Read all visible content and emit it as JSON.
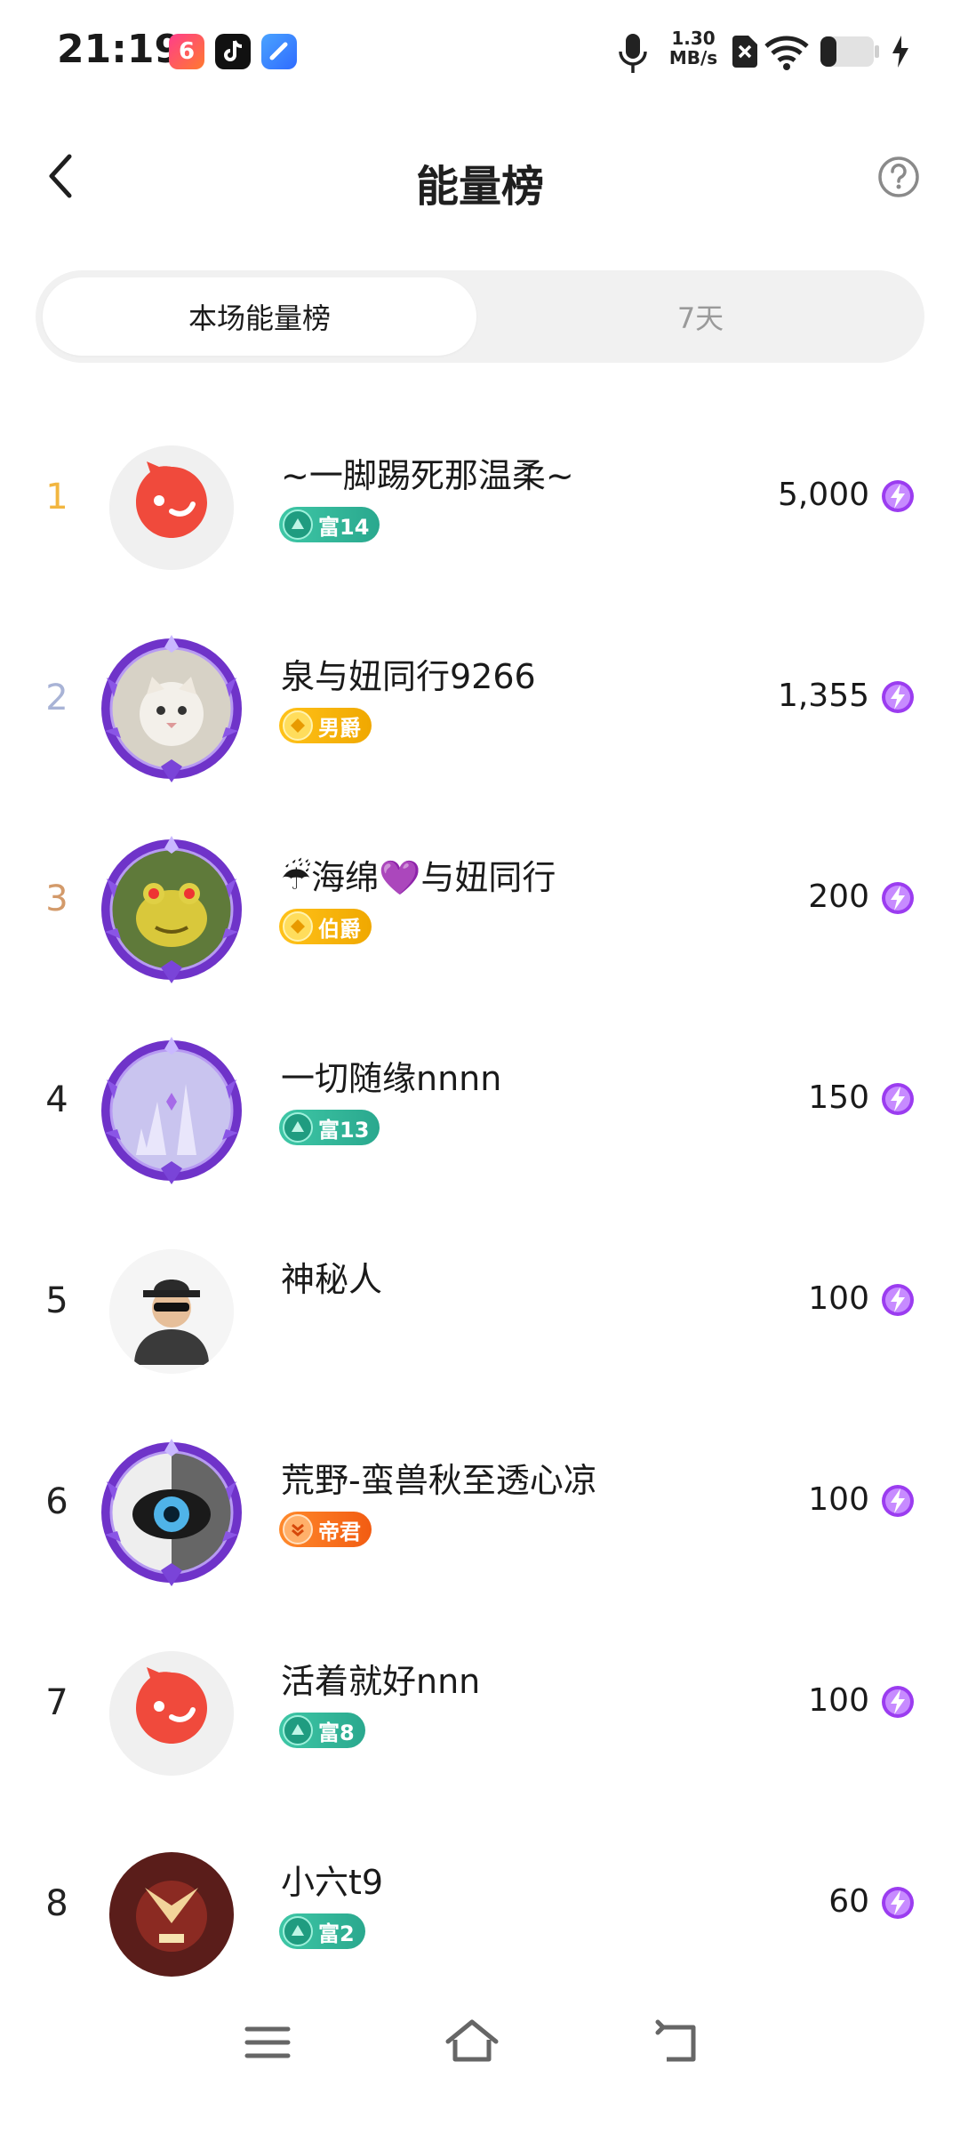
{
  "status": {
    "time": "21:19",
    "netspeed_value": "1.30",
    "netspeed_unit": "MB/s"
  },
  "header": {
    "title": "能量榜"
  },
  "tabs": [
    {
      "label": "本场能量榜",
      "active": true
    },
    {
      "label": "7天",
      "active": false
    }
  ],
  "ranking": [
    {
      "rank": "1",
      "name": "~一脚踢死那温柔~",
      "badge": "富14",
      "badge_type": "fu",
      "score": "5,000",
      "avatar": "weibo-logo"
    },
    {
      "rank": "2",
      "name": "泉与妞同行9266",
      "badge": "男爵",
      "badge_type": "jue",
      "score": "1,355",
      "avatar": "cat-photo"
    },
    {
      "rank": "3",
      "name": "☔海绵💜与妞同行",
      "badge": "伯爵",
      "badge_type": "jue",
      "score": "200",
      "avatar": "frog-photo"
    },
    {
      "rank": "4",
      "name": "一切随缘nnnn",
      "badge": "富13",
      "badge_type": "fu",
      "score": "150",
      "avatar": "crystal-photo"
    },
    {
      "rank": "5",
      "name": "神秘人",
      "badge": "",
      "badge_type": "",
      "score": "100",
      "avatar": "mystery-man"
    },
    {
      "rank": "6",
      "name": "荒野-蛮兽秋至透心凉",
      "badge": "帝君",
      "badge_type": "di",
      "score": "100",
      "avatar": "eye-photo"
    },
    {
      "rank": "7",
      "name": "活着就好nnn",
      "badge": "富8",
      "badge_type": "fu",
      "score": "100",
      "avatar": "weibo-logo"
    },
    {
      "rank": "8",
      "name": "小六t9",
      "badge": "富2",
      "badge_type": "fu",
      "score": "60",
      "avatar": "game-hero"
    }
  ],
  "colors": {
    "rank1": "#f2b640",
    "rank2": "#a8b3d6",
    "rank3": "#d39a6a",
    "energy": "#9b3cf0"
  }
}
